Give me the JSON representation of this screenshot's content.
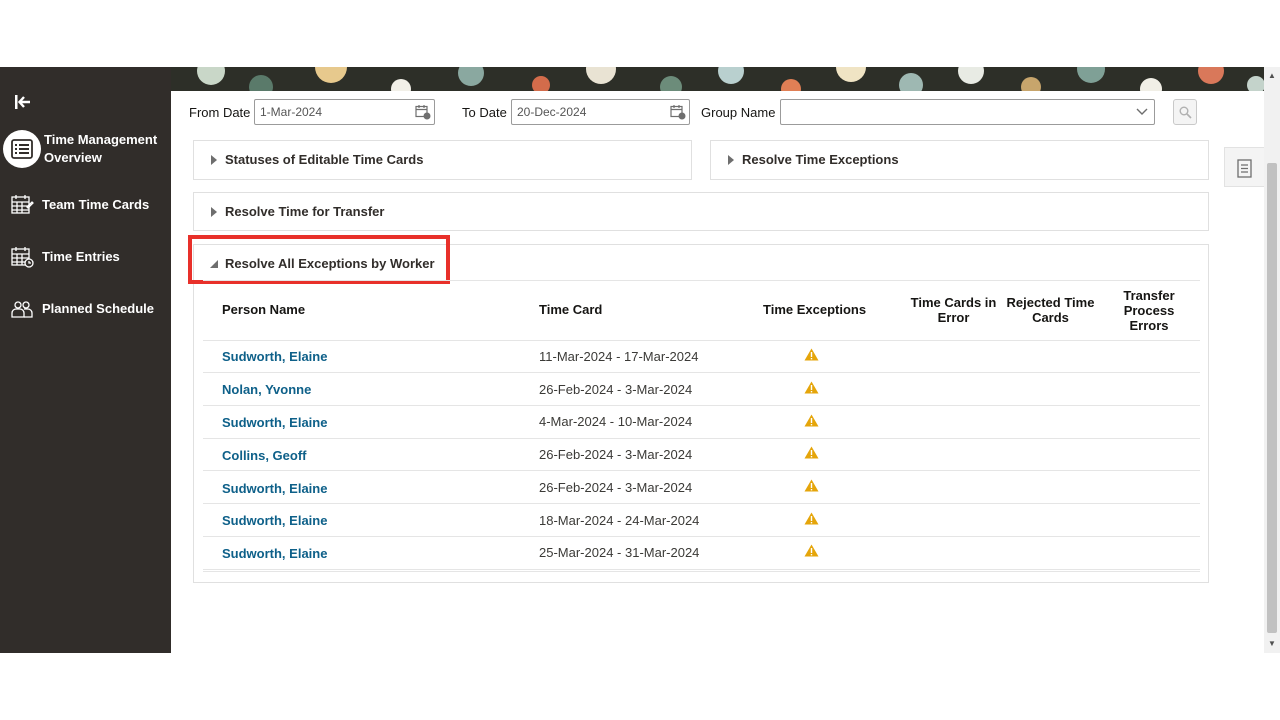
{
  "sidebar": {
    "items": [
      {
        "label": "Time Management Overview",
        "icon": "list-icon",
        "active": true
      },
      {
        "label": "Team Time Cards",
        "icon": "calendar-grid-icon"
      },
      {
        "label": "Time Entries",
        "icon": "calendar-table-icon"
      },
      {
        "label": "Planned Schedule",
        "icon": "people-icon"
      }
    ]
  },
  "filters": {
    "from_label": "From Date",
    "from_value": "1-Mar-2024",
    "to_label": "To Date",
    "to_value": "20-Dec-2024",
    "group_label": "Group Name",
    "group_value": ""
  },
  "panels": {
    "statuses": "Statuses of Editable Time Cards",
    "resolve_exceptions": "Resolve Time Exceptions",
    "resolve_transfer": "Resolve Time for Transfer",
    "resolve_by_worker": "Resolve All Exceptions by Worker"
  },
  "table": {
    "headers": {
      "person": "Person Name",
      "time_card": "Time Card",
      "exceptions": "Time Exceptions",
      "in_error_1": "Time Cards in",
      "in_error_2": "Error",
      "rejected_1": "Rejected Time",
      "rejected_2": "Cards",
      "transfer_1": "Transfer",
      "transfer_2": "Process",
      "transfer_3": "Errors"
    },
    "rows": [
      {
        "person": "Sudworth, Elaine",
        "time_card": "11-Mar-2024 - 17-Mar-2024"
      },
      {
        "person": "Nolan, Yvonne",
        "time_card": "26-Feb-2024 - 3-Mar-2024"
      },
      {
        "person": "Sudworth, Elaine",
        "time_card": "4-Mar-2024 - 10-Mar-2024"
      },
      {
        "person": "Collins, Geoff",
        "time_card": "26-Feb-2024 - 3-Mar-2024"
      },
      {
        "person": "Sudworth, Elaine",
        "time_card": "26-Feb-2024 - 3-Mar-2024"
      },
      {
        "person": "Sudworth, Elaine",
        "time_card": "18-Mar-2024 - 24-Mar-2024"
      },
      {
        "person": "Sudworth, Elaine",
        "time_card": "25-Mar-2024 - 31-Mar-2024"
      }
    ]
  },
  "colors": {
    "sidebar": "#312d2a",
    "link": "#0e6089",
    "highlight": "#e8302a",
    "warning": "#e5a50a"
  }
}
